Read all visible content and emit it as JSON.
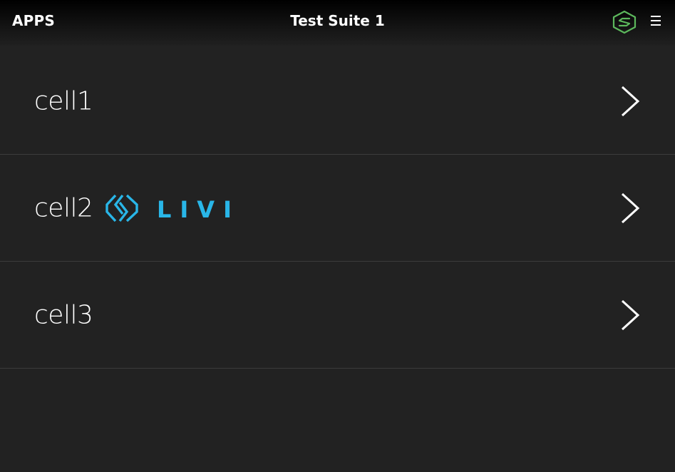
{
  "header": {
    "apps_label": "APPS",
    "title": "Test Suite 1",
    "app_icon": "sdl-logo-icon",
    "menu_icon": "hamburger-menu-icon"
  },
  "list": {
    "cells": [
      {
        "label": "cell1",
        "chevron_icon": "chevron-right-icon"
      },
      {
        "label": "cell2",
        "image": "livio-logo",
        "image_text": "LIVIO",
        "chevron_icon": "chevron-right-icon"
      },
      {
        "label": "cell3",
        "chevron_icon": "chevron-right-icon"
      }
    ]
  },
  "colors": {
    "background": "#222222",
    "header_top": "#000000",
    "text": "#ffffff",
    "divider": "#3c3c3c",
    "app_icon_green": "#5cb85c",
    "livio_blue": "#29b6e8"
  }
}
